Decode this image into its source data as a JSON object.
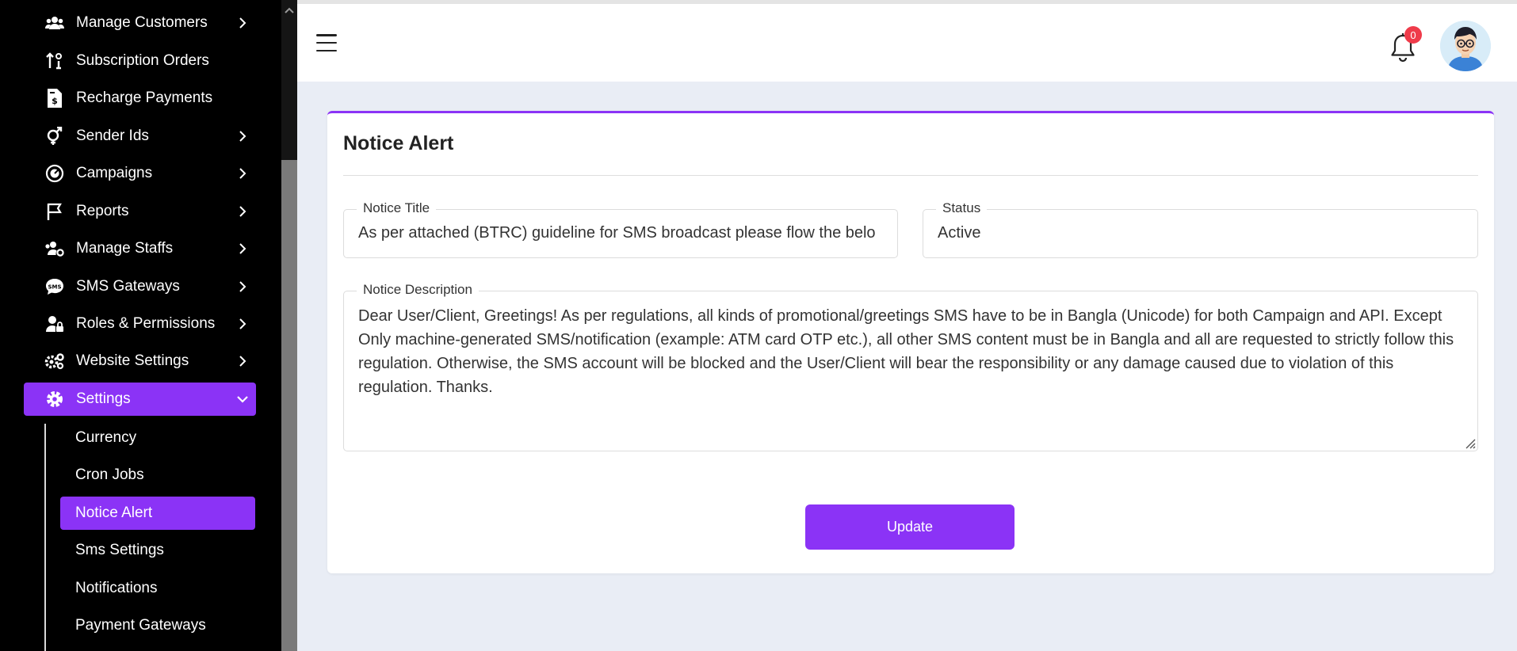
{
  "sidebar": {
    "items": [
      {
        "label": "Manage Customers",
        "icon": "users-icon",
        "chevron": true
      },
      {
        "label": "Subscription Orders",
        "icon": "sort-icon",
        "chevron": false
      },
      {
        "label": "Recharge Payments",
        "icon": "invoice-dollar-icon",
        "chevron": false
      },
      {
        "label": "Sender Ids",
        "icon": "venus-mars-icon",
        "chevron": true
      },
      {
        "label": "Campaigns",
        "icon": "bullseye-icon",
        "chevron": true
      },
      {
        "label": "Reports",
        "icon": "flag-icon",
        "chevron": true
      },
      {
        "label": "Manage Staffs",
        "icon": "users-cog-icon",
        "chevron": true
      },
      {
        "label": "SMS Gateways",
        "icon": "sms-bubble-icon",
        "chevron": true
      },
      {
        "label": "Roles & Permissions",
        "icon": "user-lock-icon",
        "chevron": true
      },
      {
        "label": "Website Settings",
        "icon": "cogs-icon",
        "chevron": true
      },
      {
        "label": "Settings",
        "icon": "gear-icon",
        "chevron": true,
        "active": true
      }
    ],
    "settings_submenu": [
      {
        "label": "Currency"
      },
      {
        "label": "Cron Jobs"
      },
      {
        "label": "Notice Alert",
        "active": true
      },
      {
        "label": "Sms Settings"
      },
      {
        "label": "Notifications"
      },
      {
        "label": "Payment Gateways"
      }
    ]
  },
  "header": {
    "notification_count": "0"
  },
  "card": {
    "title": "Notice Alert",
    "notice_title_label": "Notice Title",
    "notice_title_value": "As per attached (BTRC) guideline for SMS broadcast please flow the belo",
    "status_label": "Status",
    "status_value": "Active",
    "description_label": "Notice Description",
    "description_value": "Dear User/Client, Greetings! As per regulations, all kinds of promotional/greetings SMS have to be in Bangla (Unicode) for both Campaign and API. Except Only machine-generated SMS/notification (example: ATM card OTP etc.), all other SMS content must be in Bangla and all are requested to strictly follow this regulation. Otherwise, the SMS account will be blocked and the User/Client will bear the responsibility or any damage caused due to violation of this regulation. Thanks.",
    "update_button": "Update"
  },
  "colors": {
    "accent": "#8b33f6",
    "sidebar_bg": "#000000",
    "page_bg": "#e9edf5",
    "badge": "#ef3b4a"
  }
}
